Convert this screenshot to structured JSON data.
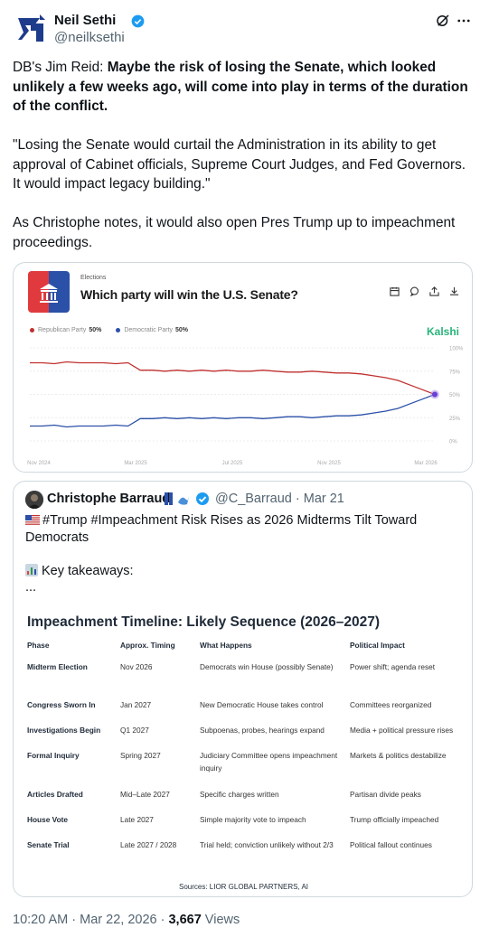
{
  "author": {
    "name": "Neil Sethi",
    "handle": "@neilksethi"
  },
  "tweet": {
    "intro": "DB's Jim Reid: ",
    "bold": "Maybe the risk of losing the Senate, which looked unlikely a few weeks ago, will come into play in terms of the duration of the conflict.",
    "para2": "\"Losing the Senate would curtail the Administration in its ability to get approval of Cabinet officials, Supreme Court Judges, and Fed Governors. It would impact legacy building.\"",
    "para3": "As Christophe notes, it would also open Pres Trump up to impeachment proceedings."
  },
  "chart_card": {
    "kicker": "Elections",
    "title": "Which party will win the U.S. Senate?",
    "brand": "Kalshi",
    "icons": [
      "calendar-icon",
      "comment-icon",
      "share-icon",
      "download-icon"
    ]
  },
  "chart_data": {
    "type": "line",
    "title": "Which party will win the U.S. Senate?",
    "x_ticks": [
      "Nov 2024",
      "Mar 2025",
      "Jul 2025",
      "Nov 2025",
      "Mar 2026"
    ],
    "y_ticks": [
      "100%",
      "75%",
      "50%",
      "25%",
      "0%"
    ],
    "ylim": [
      0,
      100
    ],
    "grid": true,
    "series": [
      {
        "name": "Republican Party",
        "legend_value": "50%",
        "color": "#c0302e",
        "values": [
          84,
          84,
          83,
          85,
          84,
          84,
          84,
          83,
          84,
          76,
          76,
          75,
          76,
          75,
          76,
          75,
          76,
          75,
          75,
          76,
          75,
          74,
          74,
          75,
          74,
          73,
          73,
          72,
          70,
          68,
          65,
          60,
          55,
          50
        ]
      },
      {
        "name": "Democratic Party",
        "legend_value": "50%",
        "color": "#2b50a8",
        "values": [
          16,
          16,
          17,
          15,
          16,
          16,
          16,
          17,
          16,
          24,
          24,
          25,
          24,
          25,
          24,
          25,
          24,
          25,
          25,
          24,
          25,
          26,
          26,
          25,
          26,
          27,
          27,
          28,
          30,
          32,
          35,
          40,
          45,
          50
        ]
      }
    ]
  },
  "quote": {
    "name": "Christophe Barraud",
    "handle": "@C_Barraud",
    "date": "Mar 21",
    "line1": "#Trump #Impeachment Risk Rises as 2026 Midterms Tilt Toward Democrats",
    "line2": "Key takeaways:",
    "line3": "...",
    "table": {
      "title": "Impeachment Timeline: Likely Sequence (2026–2027)",
      "headers": [
        "Phase",
        "Approx. Timing",
        "What Happens",
        "Political Impact"
      ],
      "rows": [
        [
          "Midterm Election",
          "Nov 2026",
          "Democrats win House (possibly Senate)",
          "Power shift; agenda reset"
        ],
        [
          "Congress Sworn In",
          "Jan 2027",
          "New Democratic House takes control",
          "Committees reorganized"
        ],
        [
          "Investigations Begin",
          "Q1 2027",
          "Subpoenas, probes, hearings expand",
          "Media + political pressure rises"
        ],
        [
          "Formal Inquiry",
          "Spring 2027",
          "Judiciary Committee opens impeachment inquiry",
          "Markets & politics destabilize"
        ],
        [
          "Articles Drafted",
          "Mid–Late 2027",
          "Specific charges written",
          "Partisan divide peaks"
        ],
        [
          "House Vote",
          "Late 2027",
          "Simple majority vote to impeach",
          "Trump officially impeached"
        ],
        [
          "Senate Trial",
          "Late 2027 / 2028",
          "Trial held; conviction unlikely without 2/3",
          "Political fallout continues"
        ]
      ],
      "sources": "Sources: LIOR GLOBAL PARTNERS, AI"
    }
  },
  "footer": {
    "time": "10:20 AM · Mar 22, 2026 · ",
    "views": "3,667",
    "views_label": " Views"
  }
}
